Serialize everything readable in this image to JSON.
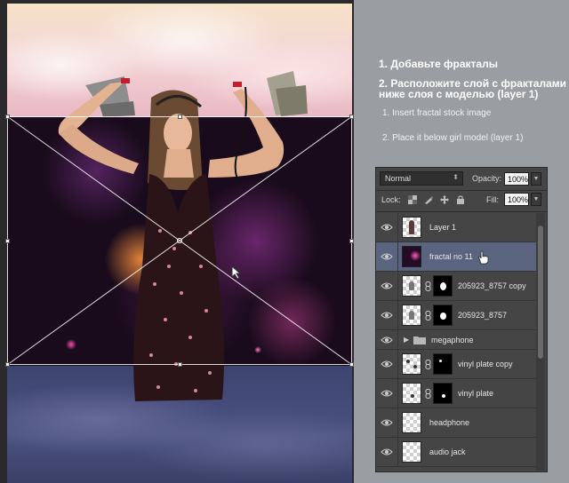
{
  "instructions": {
    "ru_step1": "1. Добавьте фракталы",
    "ru_step2_line1": "2. Расположите слой с фракталами",
    "ru_step2_line2": "ниже слоя с моделью (layer 1)",
    "en_step1": "1. Insert fractal stock image",
    "en_step2": "2. Place it below girl model (layer 1)"
  },
  "layers_panel": {
    "blend_mode": "Normal",
    "opacity_label": "Opacity:",
    "opacity_value": "100%",
    "lock_label": "Lock:",
    "fill_label": "Fill:",
    "fill_value": "100%",
    "layers": [
      {
        "name": "Layer 1",
        "type": "pixel",
        "visible": true,
        "selected": false,
        "has_mask": false
      },
      {
        "name": "fractal no 11",
        "type": "pixel",
        "visible": true,
        "selected": true,
        "has_mask": false
      },
      {
        "name": "205923_8757 copy",
        "type": "masked",
        "visible": true,
        "selected": false,
        "has_mask": true
      },
      {
        "name": "205923_8757",
        "type": "masked",
        "visible": true,
        "selected": false,
        "has_mask": true
      },
      {
        "name": "megaphone",
        "type": "group",
        "visible": true,
        "selected": false,
        "collapsed": true
      },
      {
        "name": "vinyl plate copy",
        "type": "masked",
        "visible": true,
        "selected": false,
        "has_mask": true
      },
      {
        "name": "vinyl plate",
        "type": "masked",
        "visible": true,
        "selected": false,
        "has_mask": true
      },
      {
        "name": "headphone",
        "type": "pixel",
        "visible": true,
        "selected": false,
        "has_mask": false
      },
      {
        "name": "audio jack",
        "type": "pixel",
        "visible": true,
        "selected": false,
        "has_mask": false
      }
    ]
  },
  "icons": {
    "eye": "eye-icon",
    "chain": "chain-link-icon",
    "folder": "folder-icon",
    "cursor": "hand-pointer-icon"
  },
  "colors": {
    "panel_bg": "#454545",
    "selected_row": "#5a647e",
    "page_bg": "#9a9da1"
  }
}
